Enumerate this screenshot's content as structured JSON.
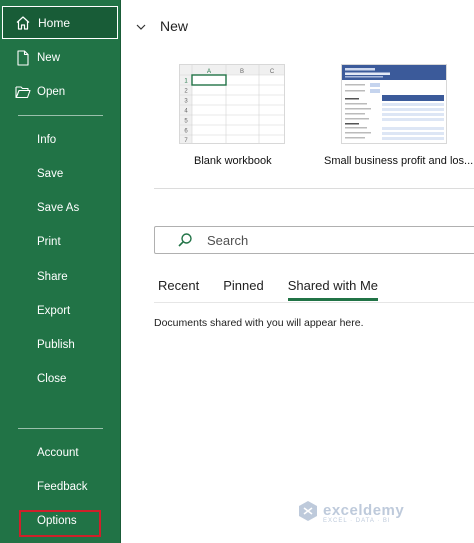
{
  "sidebar": {
    "home": {
      "label": "Home",
      "icon": "home-icon"
    },
    "items": [
      {
        "label": "New",
        "icon": "new-document-icon"
      },
      {
        "label": "Open",
        "icon": "folder-open-icon"
      },
      {
        "label": "Info"
      },
      {
        "label": "Save"
      },
      {
        "label": "Save As"
      },
      {
        "label": "Print"
      },
      {
        "label": "Share"
      },
      {
        "label": "Export"
      },
      {
        "label": "Publish"
      },
      {
        "label": "Close"
      },
      {
        "label": "Account"
      },
      {
        "label": "Feedback"
      },
      {
        "label": "Options"
      }
    ],
    "bg_color": "#217346",
    "highlight_color": "#d0202a"
  },
  "new_section": {
    "heading": "New",
    "templates": [
      {
        "label": "Blank workbook",
        "columns": [
          "A",
          "B",
          "C"
        ],
        "rows": [
          "1",
          "2",
          "3",
          "4",
          "5",
          "6",
          "7"
        ]
      },
      {
        "label": "Small business profit and los..."
      }
    ]
  },
  "search": {
    "placeholder": "Search"
  },
  "tabs": [
    {
      "label": "Recent"
    },
    {
      "label": "Pinned"
    },
    {
      "label": "Shared with Me",
      "active": true
    }
  ],
  "empty_message": "Documents shared with you will appear here.",
  "watermark": {
    "brand": "exceldemy",
    "tagline": "EXCEL · DATA · BI"
  }
}
